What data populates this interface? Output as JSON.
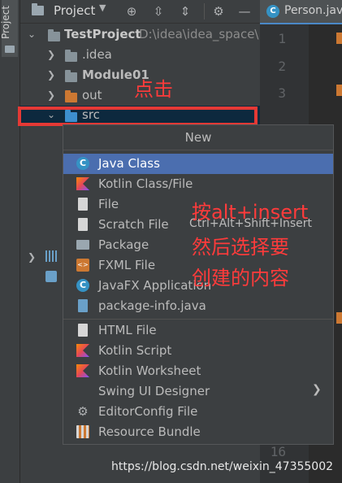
{
  "side_tab": {
    "label": "Project"
  },
  "toolbar": {
    "title": "Project",
    "icons": [
      "chevron-down-icon",
      "target-icon",
      "expand-all-icon",
      "collapse-all-icon",
      "gear-icon",
      "minus-icon"
    ]
  },
  "editor": {
    "tab_label": "Person.java",
    "tab_icon_letter": "C",
    "line_numbers": [
      "1",
      "2",
      "3",
      "16"
    ]
  },
  "tree": {
    "root_label": "TestProject",
    "root_path": "D:\\idea\\idea_space\\",
    "items": [
      {
        "label": ".idea",
        "folder_color": "#87939a"
      },
      {
        "label": "Module01",
        "folder_color": "#87939a",
        "bold": true
      },
      {
        "label": "out",
        "folder_color": "#cc7832"
      },
      {
        "label": "src",
        "folder_color": "#3d8fcf"
      }
    ]
  },
  "annotations": {
    "click": "点击",
    "line1": "按alt+insert",
    "line2": "然后选择要",
    "line3": "创建的内容"
  },
  "popup": {
    "title": "New",
    "items": [
      {
        "label": "Java Class",
        "icon": "java-class-icon",
        "icon_glyph": "C"
      },
      {
        "label": "Kotlin Class/File",
        "icon": "kotlin-class-icon"
      },
      {
        "label": "File",
        "icon": "file-icon"
      },
      {
        "label": "Scratch File",
        "icon": "scratch-file-icon",
        "shortcut": "Ctrl+Alt+Shift+Insert"
      },
      {
        "label": "Package",
        "icon": "package-icon"
      },
      {
        "label": "FXML File",
        "icon": "fxml-file-icon"
      },
      {
        "label": "JavaFX Application",
        "icon": "javafx-app-icon",
        "icon_glyph": "C"
      },
      {
        "label": "package-info.java",
        "icon": "package-info-icon"
      },
      {
        "label": "HTML File",
        "icon": "html-file-icon"
      },
      {
        "label": "Kotlin Script",
        "icon": "kotlin-script-icon"
      },
      {
        "label": "Kotlin Worksheet",
        "icon": "kotlin-worksheet-icon"
      },
      {
        "label": "Swing UI Designer",
        "icon": "",
        "submenu_arrow": "❯"
      },
      {
        "label": "EditorConfig File",
        "icon": "editorconfig-gear-icon"
      },
      {
        "label": "Resource Bundle",
        "icon": "resource-bundle-icon"
      }
    ]
  },
  "watermark": "https://blog.csdn.net/weixin_47355002",
  "colors": {
    "accent": "#4b6eaf",
    "highlight_red": "#e53935",
    "annotation_red": "#ff3b3b"
  }
}
